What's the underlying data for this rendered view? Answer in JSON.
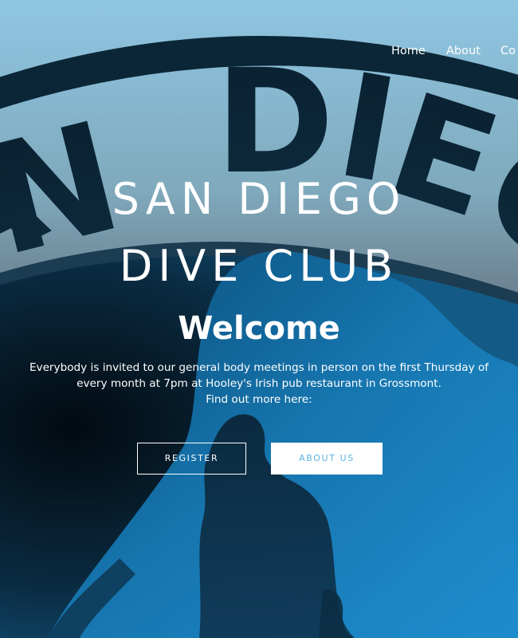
{
  "nav": {
    "home": "Home",
    "about": "About",
    "contact": "Co"
  },
  "hero": {
    "logo_text": "SAN DIEGO",
    "title_line_1": "SAN DIEGO",
    "title_line_2": "DIVE CLUB",
    "welcome": "Welcome",
    "intro_line_1": "Everybody is invited to our general body meetings in person on the first Thursday of",
    "intro_line_2": "every month at 7pm at Hooley's Irish pub restaurant in Grossmont.",
    "intro_line_3": "Find out more here:",
    "register_label": "REGISTER",
    "about_label": "ABOUT US"
  },
  "colors": {
    "sky_top": "#8fc6e2",
    "dark": "#05141f",
    "ocean_blue": "#1e8ac8",
    "accent": "#5ab4e0"
  }
}
